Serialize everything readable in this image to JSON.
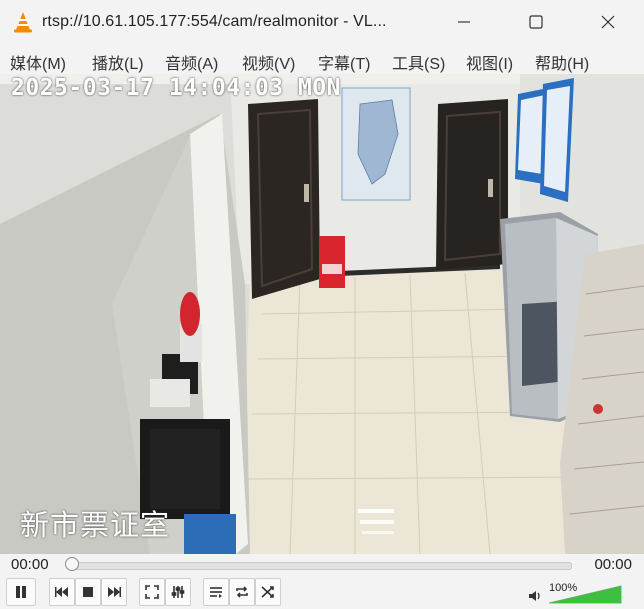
{
  "window": {
    "title": "rtsp://10.61.105.177:554/cam/realmonitor - VL...",
    "icon": "vlc-cone-icon",
    "controls": [
      "minimize-icon",
      "maximize-icon",
      "close-icon"
    ]
  },
  "menu": {
    "items": [
      "媒体(M)",
      "播放(L)",
      "音频(A)",
      "视频(V)",
      "字幕(T)",
      "工具(S)",
      "视图(I)",
      "帮助(H)"
    ]
  },
  "video": {
    "osd_timestamp": "2025-03-17 14:04:03 MON",
    "osd_room_label": "新市票证室"
  },
  "seek": {
    "current_time": "00:00",
    "total_time": "00:00",
    "position_fraction": 0
  },
  "controls": {
    "buttons": [
      "pause-icon",
      "previous-icon",
      "stop-icon",
      "next-icon",
      "fullscreen-icon",
      "extended-settings-icon",
      "playlist-icon",
      "loop-icon",
      "shuffle-icon"
    ]
  },
  "volume": {
    "label": "100%",
    "level_fraction": 1.0,
    "icon": "speaker-icon"
  },
  "colors": {
    "vlc_orange": "#f48b00",
    "volume_green": "#3fbf3f"
  }
}
